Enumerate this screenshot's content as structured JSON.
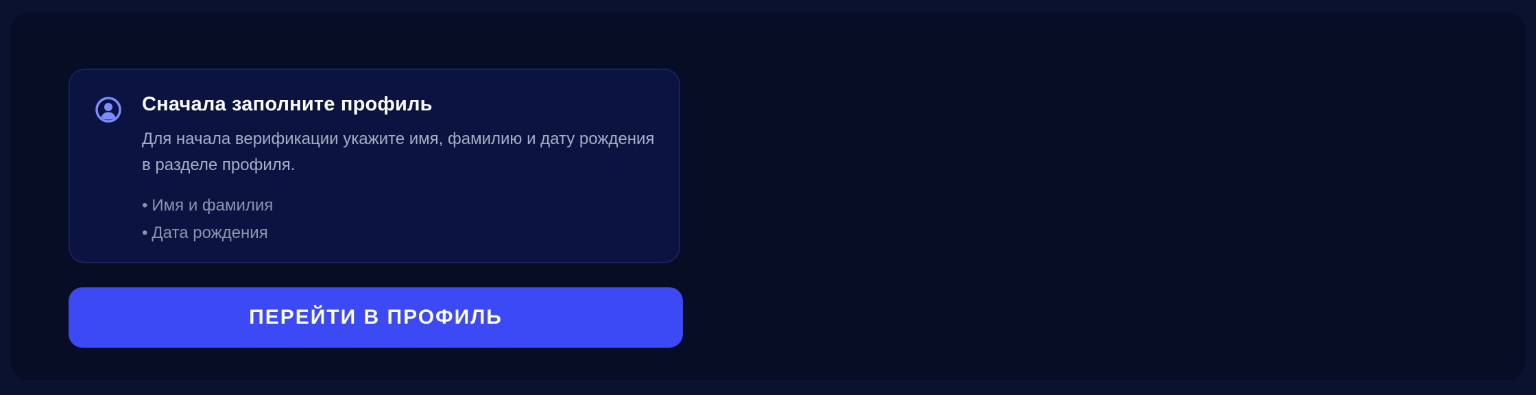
{
  "notice": {
    "icon": "user-circle-icon",
    "title": "Сначала заполните профиль",
    "description": "Для начала верификации укажите имя, фамилию и дату рождения в разделе профиля.",
    "bullet": "•",
    "requirements": [
      "Имя и фамилия",
      "Дата рождения"
    ]
  },
  "actions": {
    "go_to_profile_label": "ПЕРЕЙТИ В ПРОФИЛЬ"
  },
  "colors": {
    "background": "#0a1230",
    "panel": "#060d25",
    "card": "#0b1440",
    "accent": "#3b4af4",
    "icon": "#7d8cff"
  }
}
